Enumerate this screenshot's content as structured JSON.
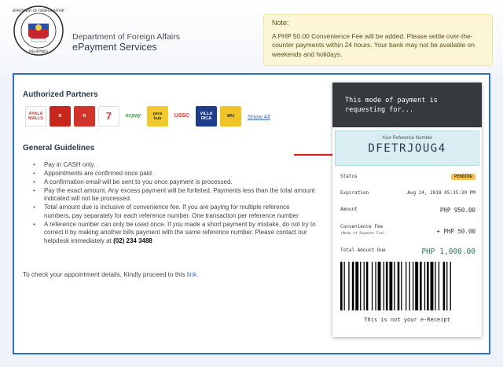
{
  "header": {
    "department": "Department of Foreign Affairs",
    "service": "ePayment Services",
    "seal_text": "DEPARTMENT OF FOREIGN AFFAIRS",
    "seal_bottom": "PHILIPPINES"
  },
  "note": {
    "title": "Note:",
    "body": "A PHP 50.00 Convenience Fee will be added. Please settle over-the-counter payments within 24 hours. Your bank may not be available on weekends and holidays."
  },
  "partners": {
    "title": "Authorized Partners",
    "logos": [
      {
        "name": "Ayala Malls",
        "color": "#d93a2b"
      },
      {
        "name": "Robinsons",
        "color": "#c8261d"
      },
      {
        "name": "Robinsons Dept",
        "color": "#d2332a"
      },
      {
        "name": "7-Eleven",
        "color": "#1e8a48"
      },
      {
        "name": "ecpay",
        "color": "#3fa34d"
      },
      {
        "name": "pera hub",
        "color": "#f1c92e"
      },
      {
        "name": "USSC",
        "color": "#e03131"
      },
      {
        "name": "Villarica",
        "color": "#1f3c8c"
      },
      {
        "name": "Western Union",
        "color": "#f0c425"
      }
    ],
    "show_all": "Show All"
  },
  "guidelines": {
    "title": "General Guidelines",
    "items": [
      "Pay in CASH only.",
      "Appointments are confirmed once paid.",
      "A confirmation email will be sent to you once payment is processed.",
      "Pay the exact amount. Any excess payment will be forfeited. Payments less than the total amount indicated will not be processed.",
      "Total amount due is inclusive of convenience fee. If you are paying for multiple reference numbers, pay separately for each reference number. One transaction per reference number",
      "A reference number can only be used once. If you made a short payment by mistake, do not try to correct it by making another bills payment with the same reference number. Please contact our helpdesk immediately at"
    ],
    "helpdesk_phone": "(02) 234 3488"
  },
  "check": {
    "text": "To check your appointment details, Kindly proceed to this",
    "link": "link."
  },
  "receipt": {
    "heading": "This mode of payment is requesting for...",
    "ref_label": "Your Reference Number",
    "ref_number": "DFETRJOUG4",
    "status_label": "Status",
    "status_value": "PENDING",
    "expiration_label": "Expiration",
    "expiration_value": "Aug 24, 2018 05:35:30 PM",
    "amount_label": "Amount",
    "amount_value": "PHP 950.00",
    "fee_label": "Convenience Fee",
    "fee_sub": "(Mode of Payment Fee)",
    "fee_value": "+ PHP 50.00",
    "total_label": "Total Amount Due",
    "total_value": "PHP 1,000.00",
    "footer": "This is not your e-Receipt"
  },
  "colors": {
    "border_blue": "#2f6fc0",
    "arrow_red": "#e02020",
    "pending_badge": "#f3c453",
    "total_green": "#2c7a55"
  }
}
